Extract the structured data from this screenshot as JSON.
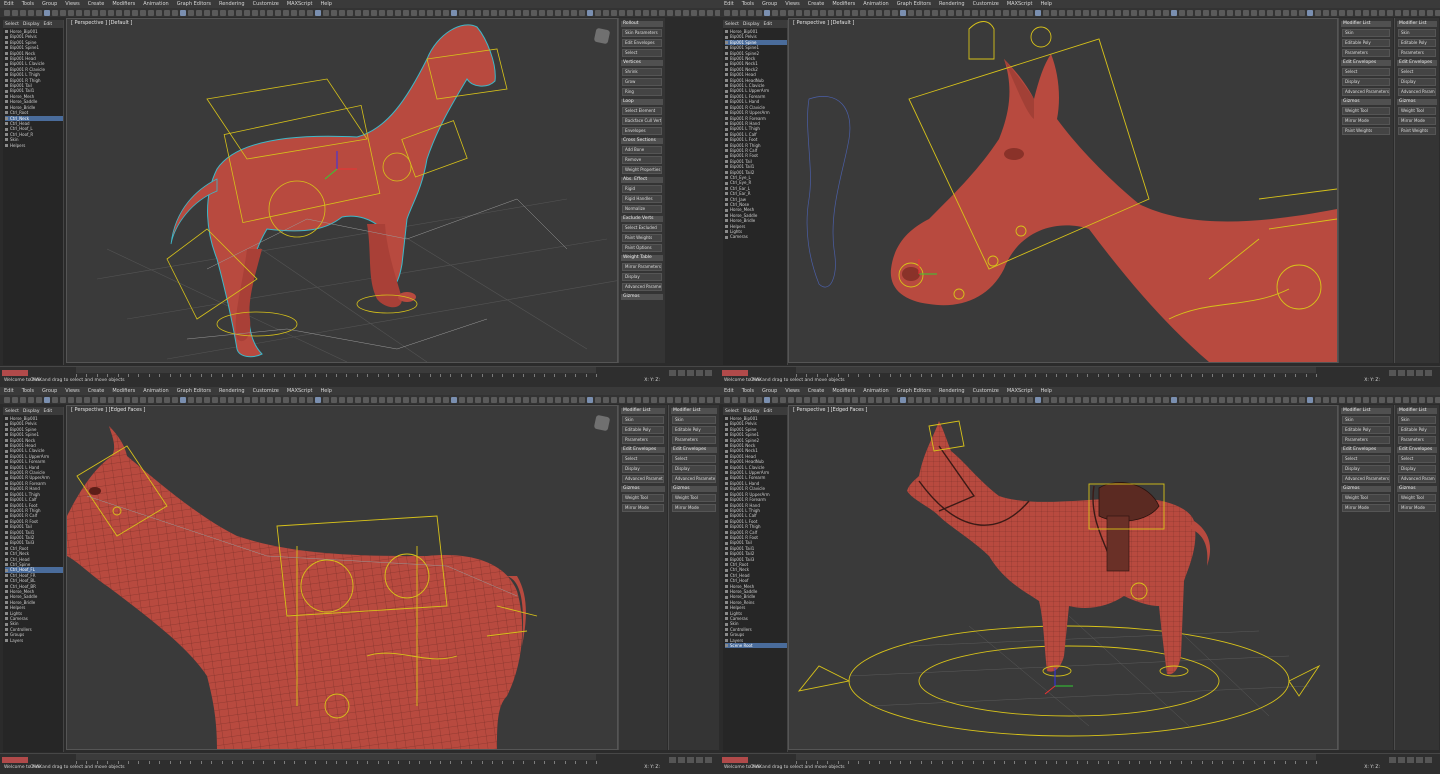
{
  "app": {
    "menus": [
      "Edit",
      "Tools",
      "Group",
      "Views",
      "Create",
      "Modifiers",
      "Animation",
      "Graph Editors",
      "Rendering",
      "Customize",
      "MAXScript",
      "Help"
    ]
  },
  "quads": [
    {
      "viewport_label": "[ Perspective ] [Default ]",
      "scene_header": [
        "Select",
        "Display",
        "Edit"
      ],
      "scene_items": [
        "Horse_Bip001",
        "Bip001 Pelvis",
        "Bip001 Spine",
        "Bip001 Spine1",
        "Bip001 Neck",
        "Bip001 Head",
        "Bip001 L Clavicle",
        "Bip001 R Clavicle",
        "Bip001 L Thigh",
        "Bip001 R Thigh",
        "Bip001 Tail",
        "Bip001 Tail1",
        "Horse_Mesh",
        "Horse_Saddle",
        "Horse_Bridle",
        "Ctrl_Root",
        "Ctrl_Neck",
        "Ctrl_Head",
        "Ctrl_Hoof_L",
        "Ctrl_Hoof_R",
        "Skin",
        "Helpers"
      ],
      "selected_index": 16,
      "panel_sections": [
        "Rollout",
        "Skin Parameters",
        "Edit Envelopes",
        "Select",
        "Vertices",
        "Shrink",
        "Grow",
        "Ring",
        "Loop",
        "Select Element",
        "Backface Cull Vertices",
        "Envelopes",
        "Cross Sections",
        "Add Bone",
        "Remove",
        "Weight Properties",
        "Abs. Effect",
        "Rigid",
        "Rigid Handles",
        "Normalize",
        "Exclude Verts",
        "Select Excluded",
        "Paint Weights",
        "Paint Options",
        "Weight Table",
        "Mirror Parameters",
        "Display",
        "Advanced Parameters",
        "Gizmos"
      ]
    },
    {
      "viewport_label": "[ Perspective ] [Default ]",
      "scene_header": [
        "Select",
        "Display",
        "Edit"
      ],
      "scene_items": [
        "Horse_Bip001",
        "Bip001 Pelvis",
        "Bip001 Spine",
        "Bip001 Spine1",
        "Bip001 Spine2",
        "Bip001 Neck",
        "Bip001 Neck1",
        "Bip001 Neck2",
        "Bip001 Head",
        "Bip001 HeadNub",
        "Bip001 L Clavicle",
        "Bip001 L UpperArm",
        "Bip001 L Forearm",
        "Bip001 L Hand",
        "Bip001 R Clavicle",
        "Bip001 R UpperArm",
        "Bip001 R Forearm",
        "Bip001 R Hand",
        "Bip001 L Thigh",
        "Bip001 L Calf",
        "Bip001 L Foot",
        "Bip001 R Thigh",
        "Bip001 R Calf",
        "Bip001 R Foot",
        "Bip001 Tail",
        "Bip001 Tail1",
        "Bip001 Tail2",
        "Ctrl_Eye_L",
        "Ctrl_Eye_R",
        "Ctrl_Ear_L",
        "Ctrl_Ear_R",
        "Ctrl_Jaw",
        "Ctrl_Nose",
        "Horse_Mesh",
        "Horse_Saddle",
        "Horse_Bridle",
        "Helpers",
        "Lights",
        "Cameras"
      ],
      "selected_index": 2,
      "panel_sections": [
        "Modifier List",
        "Skin",
        "Editable Poly",
        "Parameters",
        "Edit Envelopes",
        "Select",
        "Display",
        "Advanced Parameters",
        "Gizmos",
        "Weight Tool",
        "Mirror Mode",
        "Paint Weights"
      ]
    },
    {
      "viewport_label": "[ Perspective ] [Edged Faces ]",
      "scene_header": [
        "Select",
        "Display",
        "Edit"
      ],
      "scene_items": [
        "Horse_Bip001",
        "Bip001 Pelvis",
        "Bip001 Spine",
        "Bip001 Spine1",
        "Bip001 Neck",
        "Bip001 Head",
        "Bip001 L Clavicle",
        "Bip001 L UpperArm",
        "Bip001 L Forearm",
        "Bip001 L Hand",
        "Bip001 R Clavicle",
        "Bip001 R UpperArm",
        "Bip001 R Forearm",
        "Bip001 R Hand",
        "Bip001 L Thigh",
        "Bip001 L Calf",
        "Bip001 L Foot",
        "Bip001 R Thigh",
        "Bip001 R Calf",
        "Bip001 R Foot",
        "Bip001 Tail",
        "Bip001 Tail1",
        "Bip001 Tail2",
        "Bip001 Tail3",
        "Ctrl_Root",
        "Ctrl_Neck",
        "Ctrl_Head",
        "Ctrl_Spine",
        "Ctrl_Hoof_FL",
        "Ctrl_Hoof_FR",
        "Ctrl_Hoof_BL",
        "Ctrl_Hoof_BR",
        "Horse_Mesh",
        "Horse_Saddle",
        "Horse_Bridle",
        "Helpers",
        "Lights",
        "Cameras",
        "Skin",
        "Controllers",
        "Groups",
        "Layers"
      ],
      "selected_index": 28,
      "panel_sections": [
        "Modifier List",
        "Skin",
        "Editable Poly",
        "Parameters",
        "Edit Envelopes",
        "Select",
        "Display",
        "Advanced Parameters",
        "Gizmos",
        "Weight Tool",
        "Mirror Mode"
      ]
    },
    {
      "viewport_label": "[ Perspective ] [Edged Faces ]",
      "scene_header": [
        "Select",
        "Display",
        "Edit"
      ],
      "scene_items": [
        "Horse_Bip001",
        "Bip001 Pelvis",
        "Bip001 Spine",
        "Bip001 Spine1",
        "Bip001 Spine2",
        "Bip001 Neck",
        "Bip001 Neck1",
        "Bip001 Head",
        "Bip001 HeadNub",
        "Bip001 L Clavicle",
        "Bip001 L UpperArm",
        "Bip001 L Forearm",
        "Bip001 L Hand",
        "Bip001 R Clavicle",
        "Bip001 R UpperArm",
        "Bip001 R Forearm",
        "Bip001 R Hand",
        "Bip001 L Thigh",
        "Bip001 L Calf",
        "Bip001 L Foot",
        "Bip001 R Thigh",
        "Bip001 R Calf",
        "Bip001 R Foot",
        "Bip001 Tail",
        "Bip001 Tail1",
        "Bip001 Tail2",
        "Bip001 Tail3",
        "Ctrl_Root",
        "Ctrl_Neck",
        "Ctrl_Head",
        "Ctrl_Hoof",
        "Horse_Mesh",
        "Horse_Saddle",
        "Horse_Bridle",
        "Horse_Reins",
        "Helpers",
        "Lights",
        "Cameras",
        "Skin",
        "Controllers",
        "Groups",
        "Layers",
        "Scene Root"
      ],
      "selected_index": 42,
      "panel_sections": [
        "Modifier List",
        "Skin",
        "Editable Poly",
        "Parameters",
        "Edit Envelopes",
        "Select",
        "Display",
        "Advanced Parameters",
        "Gizmos",
        "Weight Tool",
        "Mirror Mode"
      ]
    }
  ],
  "status": {
    "max_label": "Welcome to MAX",
    "prompt": "Click and drag to select and move objects",
    "coords": "X:    Y:    Z:"
  },
  "colors": {
    "viewport_bg": "#3a3a3a",
    "horse": "#b84a3f",
    "rig": "#d7c21a",
    "selection": "#4a6c9b"
  }
}
